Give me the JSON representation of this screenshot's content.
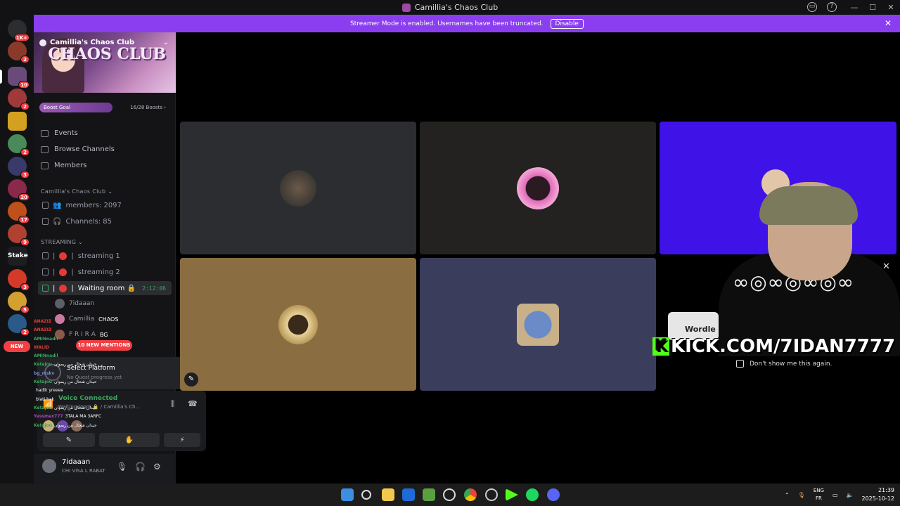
{
  "window": {
    "title": "Camillia's Chaos Club",
    "controls": [
      "—",
      "☐",
      "✕"
    ]
  },
  "streamer_banner": {
    "text": "Streamer Mode is enabled. Usernames have been truncated.",
    "button": "Disable",
    "close": "✕"
  },
  "server_rail": {
    "badges": [
      "1K+",
      "2",
      "10",
      "2",
      "2",
      "3",
      "20",
      "17",
      "9",
      "3",
      "5",
      "2"
    ],
    "new_label": "NEW"
  },
  "server": {
    "name": "Camillia's Chaos Club",
    "banner_text": "CHAOS CLUB",
    "boost_goal_label": "Boost Goal",
    "boost_count": "16/28 Boosts ›",
    "nav": [
      "Events",
      "Browse Channels",
      "Members"
    ],
    "category1": "Camillia's Chaos Club ⌄",
    "stat_members": "members: 2097",
    "stat_channels": "Channels: 85",
    "category2": "STREAMING ⌄",
    "channels": [
      {
        "name": "streaming 1"
      },
      {
        "name": "streaming 2"
      },
      {
        "name": "Waiting room 🔒",
        "timer": "2:12:06"
      }
    ],
    "members": [
      {
        "name": "7idaaan",
        "tag": ""
      },
      {
        "name": "Camillia",
        "tag": "CHAOS"
      },
      {
        "name": "F R I R A",
        "tag": "BG"
      }
    ],
    "mentions": "10 NEW MENTIONS"
  },
  "quest": {
    "title": "Select Platform",
    "subtitle": "No Quest progress yet"
  },
  "voice": {
    "status": "Voice Connected",
    "channel": "Waiting room 🔒 / Camillia's Ch..."
  },
  "voice_buttons": [
    "✎",
    "✋",
    "⚡"
  ],
  "user": {
    "name": "7idaaan",
    "status": "CHI VISA L RABAT"
  },
  "chat_overlay": [
    {
      "user": "ANAZIZ",
      "msg": "",
      "color": "#e53935"
    },
    {
      "user": "ANAZIZ",
      "msg": "",
      "color": "#e53935"
    },
    {
      "user": "AMINnadil",
      "msg": "",
      "color": "#3ba55c"
    },
    {
      "user": "WALID",
      "msg": "",
      "color": "#e53935"
    },
    {
      "user": "AMINnadil",
      "msg": "",
      "color": "#3ba55c"
    },
    {
      "user": "Ketajou",
      "msg": "حيدان شحال من ريموان",
      "color": "#3ba55c"
    },
    {
      "user": "bg_mskv",
      "msg": "",
      "color": "#7289da"
    },
    {
      "user": "Ketajou",
      "msg": "حيدان شحال من ريموان",
      "color": "#3ba55c"
    },
    {
      "user": "",
      "msg": "hadik yreeee",
      "color": "#fff"
    },
    {
      "user": "",
      "msg": "blati hak",
      "color": "#fff"
    },
    {
      "user": "Ketajou",
      "msg": "حيدان شحال من ريموان",
      "color": "#3ba55c"
    },
    {
      "user": "Yassmax777",
      "msg": "3TALA MA 3ARFC",
      "color": "#ab47bc"
    },
    {
      "user": "Ketajou",
      "msg": "حيدان شحال من ريموان",
      "color": "#3ba55c"
    }
  ],
  "overlay": {
    "kick_url": "KICK.COM/7IDAN7777",
    "wordle": "Wordle",
    "dont_show": "Don't show me this again."
  },
  "taskbar": {
    "lang": "ENG",
    "region": "FR",
    "time": "21:39",
    "date": "2025-10-12"
  },
  "colors": {
    "streamer": "#8a3ef0",
    "kick": "#53fc18",
    "accent_red": "#f23f43"
  }
}
